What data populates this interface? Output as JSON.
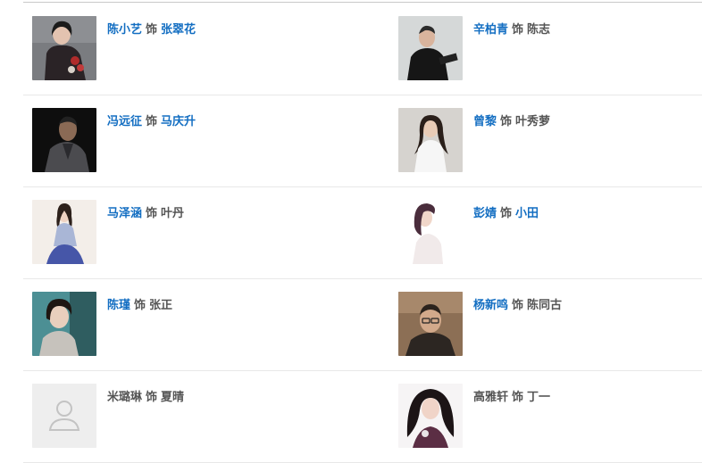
{
  "sep_label": "饰",
  "cast": [
    {
      "actor": "陈小艺",
      "actor_link": true,
      "character": "张翠花",
      "character_link": true,
      "icon": "actor-portrait"
    },
    {
      "actor": "辛柏青",
      "actor_link": true,
      "character": "陈志",
      "character_link": false,
      "icon": "actor-portrait"
    },
    {
      "actor": "冯远征",
      "actor_link": true,
      "character": "马庆升",
      "character_link": true,
      "icon": "actor-portrait"
    },
    {
      "actor": "曾黎",
      "actor_link": true,
      "character": "叶秀萝",
      "character_link": false,
      "icon": "actor-portrait"
    },
    {
      "actor": "马泽涵",
      "actor_link": true,
      "character": "叶丹",
      "character_link": false,
      "icon": "actor-portrait"
    },
    {
      "actor": "彭婧",
      "actor_link": true,
      "character": "小田",
      "character_link": true,
      "icon": "actor-portrait"
    },
    {
      "actor": "陈瑾",
      "actor_link": true,
      "character": "张正",
      "character_link": false,
      "icon": "actor-portrait"
    },
    {
      "actor": "杨新鸣",
      "actor_link": true,
      "character": "陈同古",
      "character_link": false,
      "icon": "actor-portrait"
    },
    {
      "actor": "米璐琳",
      "actor_link": false,
      "character": "夏晴",
      "character_link": false,
      "icon": "default-avatar-icon"
    },
    {
      "actor": "高雅轩",
      "actor_link": false,
      "character": "丁一",
      "character_link": false,
      "icon": "actor-portrait"
    }
  ],
  "colors": {
    "link": "#136ec2",
    "text": "#555555",
    "divider": "#e8e8e8"
  }
}
